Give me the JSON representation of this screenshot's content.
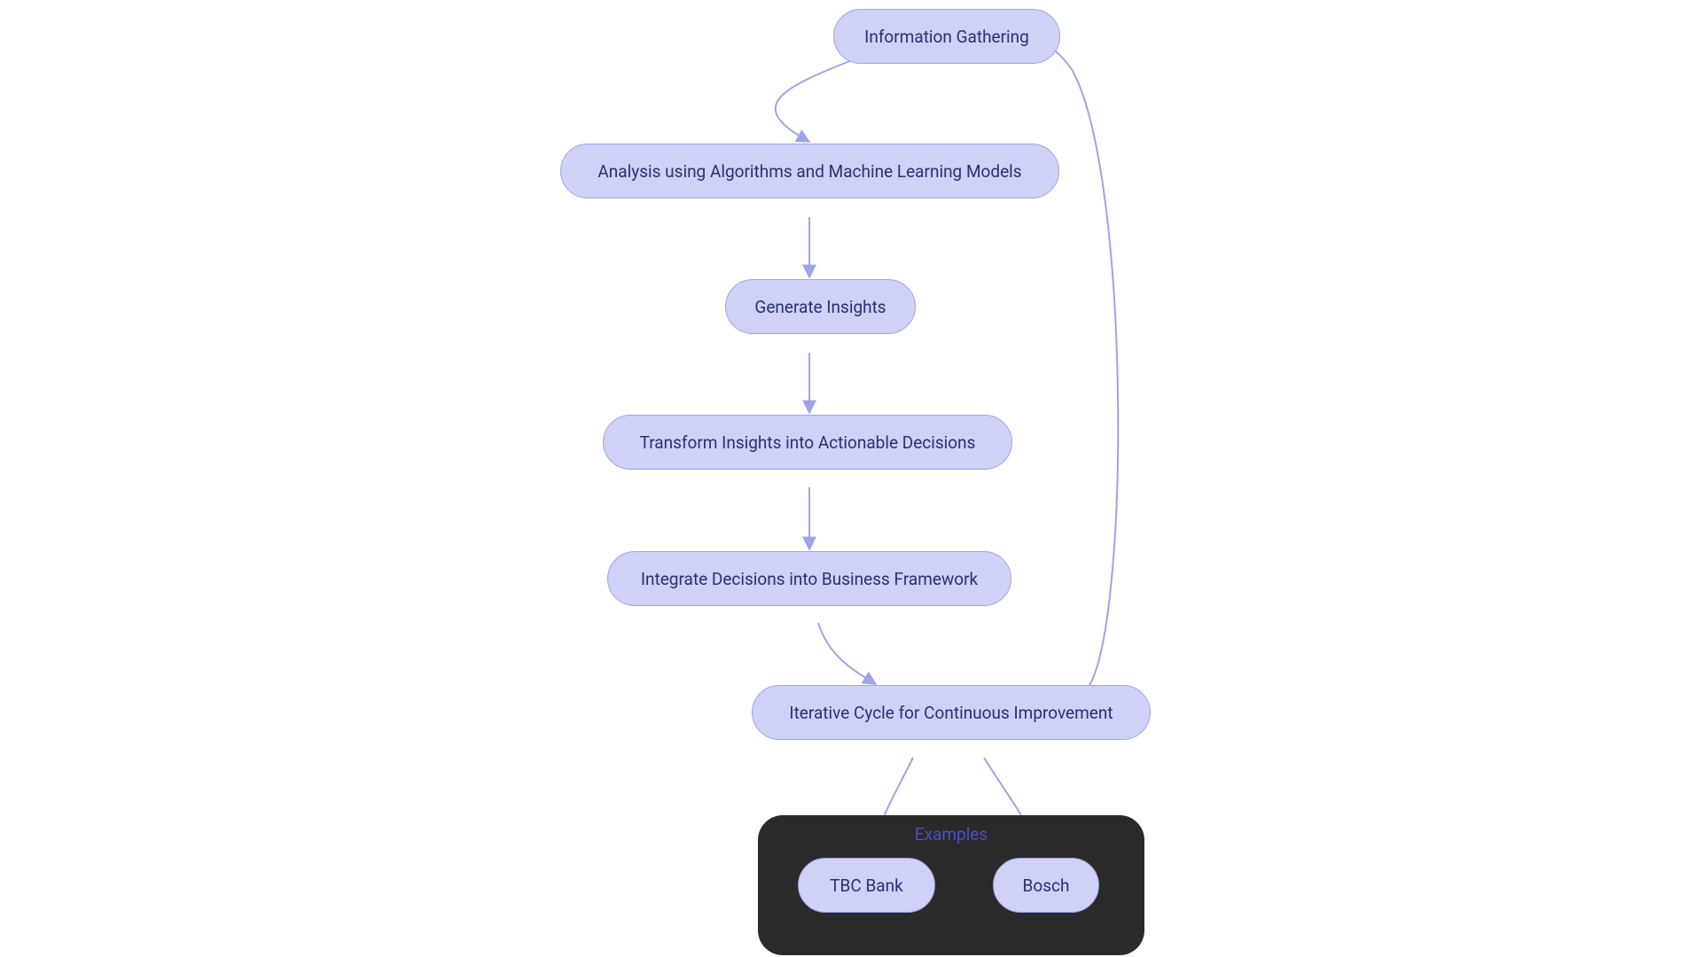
{
  "nodes": {
    "n1": {
      "label": "Information Gathering"
    },
    "n2": {
      "label": "Analysis using Algorithms and Machine Learning Models"
    },
    "n3": {
      "label": "Generate Insights"
    },
    "n4": {
      "label": "Transform Insights into Actionable Decisions"
    },
    "n5": {
      "label": "Integrate Decisions into Business Framework"
    },
    "n6": {
      "label": "Iterative Cycle for Continuous Improvement"
    },
    "n7": {
      "label": "TBC Bank"
    },
    "n8": {
      "label": "Bosch"
    }
  },
  "group": {
    "label": "Examples"
  },
  "colors": {
    "node_fill": "#cfd1f7",
    "node_stroke": "#9ea3ea",
    "node_text": "#2c2f72",
    "edge_stroke": "#9ea3ea",
    "group_fill": "#2a2a2a",
    "group_label": "#4a4fbf"
  },
  "chart_data": {
    "type": "flowchart",
    "nodes": [
      {
        "id": "n1",
        "label": "Information Gathering"
      },
      {
        "id": "n2",
        "label": "Analysis using Algorithms and Machine Learning Models"
      },
      {
        "id": "n3",
        "label": "Generate Insights"
      },
      {
        "id": "n4",
        "label": "Transform Insights into Actionable Decisions"
      },
      {
        "id": "n5",
        "label": "Integrate Decisions into Business Framework"
      },
      {
        "id": "n6",
        "label": "Iterative Cycle for Continuous Improvement"
      },
      {
        "id": "n7",
        "label": "TBC Bank",
        "group": "Examples"
      },
      {
        "id": "n8",
        "label": "Bosch",
        "group": "Examples"
      }
    ],
    "edges": [
      {
        "from": "n1",
        "to": "n2"
      },
      {
        "from": "n2",
        "to": "n3"
      },
      {
        "from": "n3",
        "to": "n4"
      },
      {
        "from": "n4",
        "to": "n5"
      },
      {
        "from": "n5",
        "to": "n6"
      },
      {
        "from": "n6",
        "to": "n1",
        "feedback": true
      },
      {
        "from": "n6",
        "to": "n7"
      },
      {
        "from": "n6",
        "to": "n8"
      }
    ],
    "groups": [
      {
        "id": "Examples",
        "label": "Examples",
        "members": [
          "n7",
          "n8"
        ]
      }
    ]
  }
}
